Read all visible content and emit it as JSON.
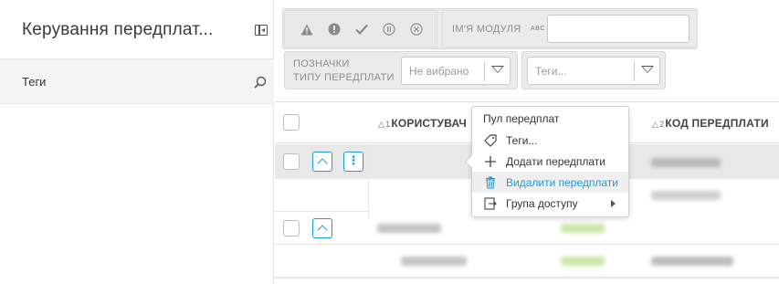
{
  "left_panel": {
    "title": "Керування передплат...",
    "row_label": "Теги",
    "collapse_icon": "collapse-panel-icon",
    "search_icon": "search-icon"
  },
  "filters": {
    "status_icons": [
      "warning-icon",
      "error-icon",
      "check-icon",
      "pause-icon",
      "cancel-icon"
    ],
    "module_label": "ІМ'Я МОДУЛЯ",
    "module_type_hint": "ABC",
    "module_value": "",
    "tags_label_line1": "ПОЗНАЧКИ",
    "tags_label_line2": "ТИПУ ПЕРЕДПЛАТИ",
    "tags_select_placeholder": "Не вибрано",
    "tags2_select_placeholder": "Теги..."
  },
  "table": {
    "columns": [
      {
        "sort_order": "1",
        "label": "КОРИСТУВАЧ"
      },
      {
        "sort_order": "2",
        "label": "КОД ПЕРЕДПЛАТИ"
      }
    ]
  },
  "context_menu": {
    "header": "Пул передплат",
    "items": [
      {
        "label": "Теги...",
        "icon": "tag-icon"
      },
      {
        "label": "Додати передплати",
        "icon": "plus-icon"
      },
      {
        "label": "Видалити передплати",
        "icon": "trash-icon",
        "highlighted": true
      },
      {
        "label": "Група доступу",
        "icon": "access-group-icon",
        "has_submenu": true
      }
    ]
  },
  "colors": {
    "accent": "#1f9bd0",
    "panel_bg": "#f4f4f4",
    "filter_bg": "#ebebeb",
    "highlight_row": "#e8e8e8"
  }
}
